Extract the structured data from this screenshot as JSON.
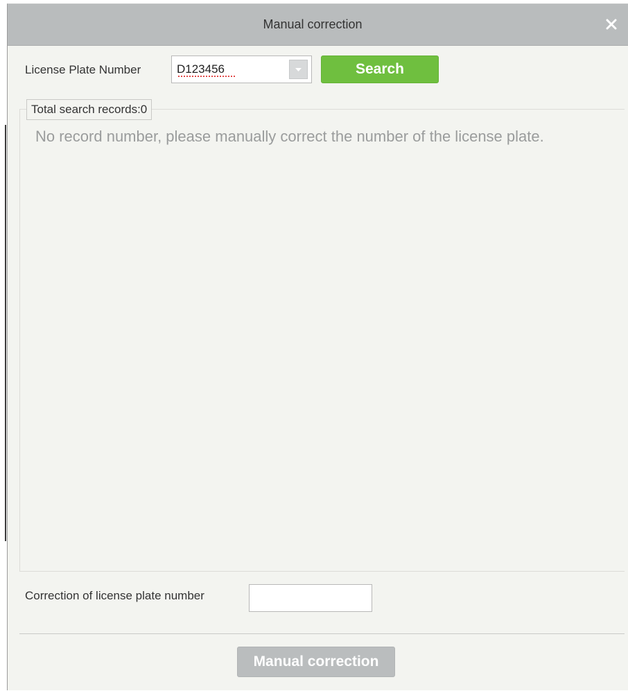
{
  "dialog": {
    "title": "Manual correction",
    "close_icon": "close-icon"
  },
  "search": {
    "label": "License Plate Number",
    "value": "D123456",
    "dropdown_icon": "chevron-down-icon",
    "button_label": "Search"
  },
  "results": {
    "legend": "Total search records:0",
    "empty_message": "No record number, please manually correct the number of the license plate."
  },
  "correction": {
    "label": "Correction of license plate number",
    "value": ""
  },
  "footer": {
    "button_label": "Manual correction"
  },
  "colors": {
    "titlebar": "#b9bcbd",
    "panel": "#f3f4f0",
    "search_button": "#6fbf3f",
    "disabled_button": "#babdbe",
    "muted_text": "#9a9c9c"
  }
}
